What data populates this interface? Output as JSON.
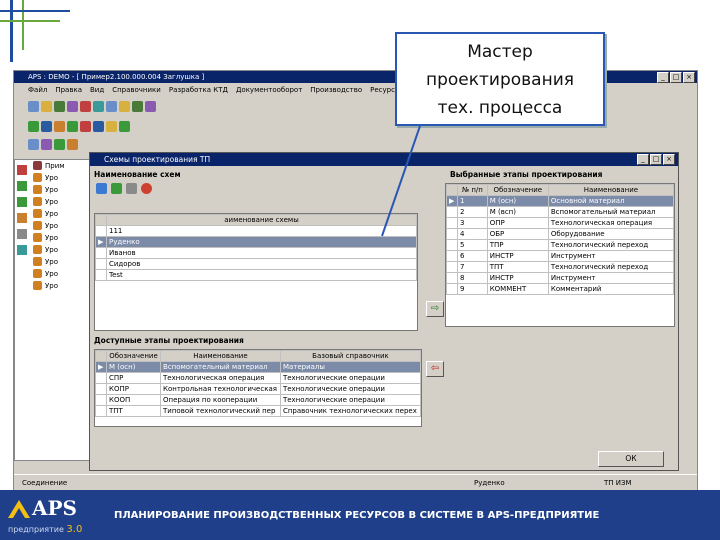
{
  "callout": {
    "line1": "Мастер",
    "line2": "проектирования",
    "line3": "тех. процесса"
  },
  "app": {
    "title": "APS : DEMO - [ Пример2.100.000.004 Заглушка ]",
    "menu": [
      "Файл",
      "Правка",
      "Вид",
      "Справочники",
      "Разработка КТД",
      "Документооборот",
      "Производство",
      "Ресурсы"
    ],
    "tree_items": [
      "Прим",
      "Уро",
      "Уро",
      "Уро",
      "Уро",
      "Уро",
      "Уро",
      "Уро",
      "Уро",
      "Уро",
      "Уро"
    ],
    "status_left": "Соединение",
    "status_mid": "Руденко"
  },
  "dialog": {
    "title": "Схемы проектирования ТП",
    "schemes_title": "Наименование схем",
    "schemes_header": "аименование схемы",
    "schemes": [
      "111",
      "Руденко",
      "Иванов",
      "Сидоров",
      "Test"
    ],
    "selected_scheme": 1,
    "chosen_title": "Выбранные этапы проектирования",
    "chosen_headers": [
      "№ п/п",
      "Обозначение",
      "Наименование"
    ],
    "chosen": [
      [
        "1",
        "М (осн)",
        "Основной материал"
      ],
      [
        "2",
        "М (всп)",
        "Вспомогательный материал"
      ],
      [
        "3",
        "ОПР",
        "Технологическая операция"
      ],
      [
        "4",
        "ОБР",
        "Оборудование"
      ],
      [
        "5",
        "ТПР",
        "Технологический переход"
      ],
      [
        "6",
        "ИНСТР",
        "Инструмент"
      ],
      [
        "7",
        "ТПТ",
        "Технологический переход"
      ],
      [
        "8",
        "ИНСТР",
        "Инструмент"
      ],
      [
        "9",
        "КОММЕНТ",
        "Комментарий"
      ]
    ],
    "available_title": "Доступные этапы проектирования",
    "available_headers": [
      "Обозначение",
      "Наименование",
      "Базовый справочник"
    ],
    "available": [
      [
        "М (осн)",
        "Вспомогательный материал",
        "Материалы"
      ],
      [
        "СПР",
        "Технологическая операция",
        "Технологические операции"
      ],
      [
        "КОПР",
        "Контрольная технологическая",
        "Технологические операции"
      ],
      [
        "КООП",
        "Операция по кооперации",
        "Технологические операции"
      ],
      [
        "ТПТ",
        "Типовой технологический пер",
        "Справочник технологических перех"
      ]
    ],
    "ok_label": "ОК",
    "status_right": "ТП ИЗМ"
  },
  "footer": {
    "logo_text": "APS",
    "logo_sub": "предприятие",
    "logo_version": "3.0",
    "tagline": "ПЛАНИРОВАНИЕ ПРОИЗВОДСТВЕННЫХ РЕСУРСОВ В СИСТЕМЕ В APS-ПРЕДПРИЯТИЕ"
  },
  "colors": {
    "accent": "#1f3f8a",
    "titlebar": "#0a246a",
    "selection": "#7b8ba8",
    "callout_border": "#2a56b4"
  }
}
